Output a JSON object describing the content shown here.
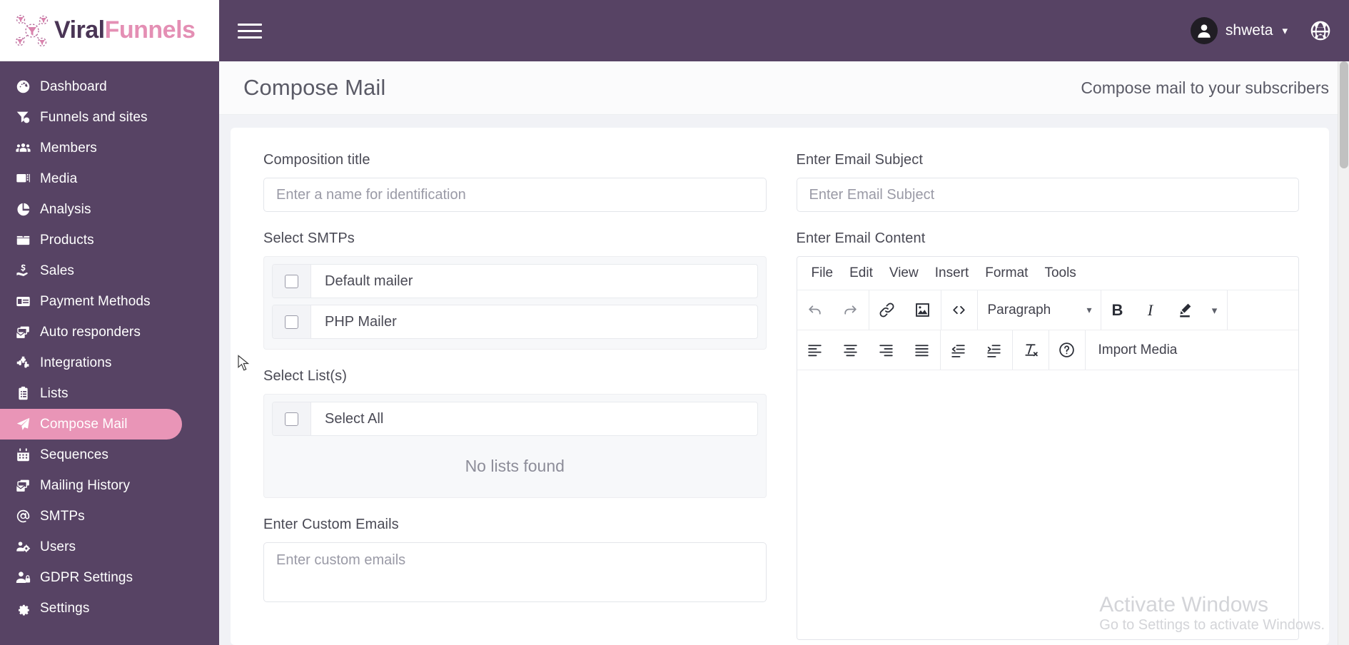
{
  "brand": {
    "part1": "Viral",
    "part2": "Funnels",
    "logo_icon": "funnel-network-logo"
  },
  "sidebar": {
    "items": [
      {
        "label": "Dashboard",
        "icon": "dashboard-icon",
        "active": false
      },
      {
        "label": "Funnels and sites",
        "icon": "funnel-icon",
        "active": false
      },
      {
        "label": "Members",
        "icon": "members-icon",
        "active": false
      },
      {
        "label": "Media",
        "icon": "media-icon",
        "active": false
      },
      {
        "label": "Analysis",
        "icon": "pie-chart-icon",
        "active": false
      },
      {
        "label": "Products",
        "icon": "products-box-icon",
        "active": false
      },
      {
        "label": "Sales",
        "icon": "sales-hand-icon",
        "active": false
      },
      {
        "label": "Payment Methods",
        "icon": "credit-card-icon",
        "active": false
      },
      {
        "label": "Auto responders",
        "icon": "auto-responder-icon",
        "active": false
      },
      {
        "label": "Integrations",
        "icon": "puzzle-icon",
        "active": false
      },
      {
        "label": "Lists",
        "icon": "clipboard-icon",
        "active": false
      },
      {
        "label": "Compose Mail",
        "icon": "paper-plane-icon",
        "active": true
      },
      {
        "label": "Sequences",
        "icon": "calendar-icon",
        "active": false
      },
      {
        "label": "Mailing History",
        "icon": "mail-history-icon",
        "active": false
      },
      {
        "label": "SMTPs",
        "icon": "at-sign-icon",
        "active": false
      },
      {
        "label": "Users",
        "icon": "users-gear-icon",
        "active": false
      },
      {
        "label": "GDPR Settings",
        "icon": "user-lock-icon",
        "active": false
      },
      {
        "label": "Settings",
        "icon": "gear-icon",
        "active": false
      }
    ]
  },
  "topbar": {
    "menu_icon": "hamburger-icon",
    "user_name": "shweta",
    "user_avatar_icon": "user-avatar-icon",
    "caret_icon": "chevron-down-icon",
    "language_icon": "globe-icon"
  },
  "page": {
    "title": "Compose Mail",
    "subtitle": "Compose mail to your subscribers"
  },
  "form": {
    "composition_title_label": "Composition title",
    "composition_title_placeholder": "Enter a name for identification",
    "composition_title_value": "",
    "smtp_label": "Select SMTPs",
    "smtps": [
      {
        "label": "Default mailer",
        "checked": false
      },
      {
        "label": "PHP Mailer",
        "checked": false
      }
    ],
    "lists_label": "Select List(s)",
    "select_all_label": "Select All",
    "select_all_checked": false,
    "no_lists_message": "No lists found",
    "custom_emails_label": "Enter Custom Emails",
    "custom_emails_placeholder": "Enter custom emails",
    "custom_emails_value": ""
  },
  "email": {
    "subject_label": "Enter Email Subject",
    "subject_placeholder": "Enter Email Subject",
    "subject_value": "",
    "content_label": "Enter Email Content",
    "editor": {
      "menus": [
        "File",
        "Edit",
        "View",
        "Insert",
        "Format",
        "Tools"
      ],
      "row1": {
        "undo_icon": "undo-icon",
        "redo_icon": "redo-icon",
        "link_icon": "link-icon",
        "image_icon": "image-icon",
        "code_icon": "source-code-icon",
        "block_format": "Paragraph",
        "block_format_caret": "chevron-down-icon",
        "bold_label": "B",
        "italic_label": "I",
        "highlight_icon": "text-color-icon",
        "highlight_caret": "chevron-down-icon"
      },
      "row2": {
        "align_left_icon": "align-left-icon",
        "align_center_icon": "align-center-icon",
        "align_right_icon": "align-right-icon",
        "align_justify_icon": "align-justify-icon",
        "outdent_icon": "outdent-icon",
        "indent_icon": "indent-icon",
        "clear_format_icon": "clear-formatting-icon",
        "help_icon": "help-circle-icon",
        "import_media_label": "Import Media"
      },
      "body_content": ""
    }
  },
  "watermark": {
    "line1": "Activate Windows",
    "line2": "Go to Settings to activate Windows."
  }
}
